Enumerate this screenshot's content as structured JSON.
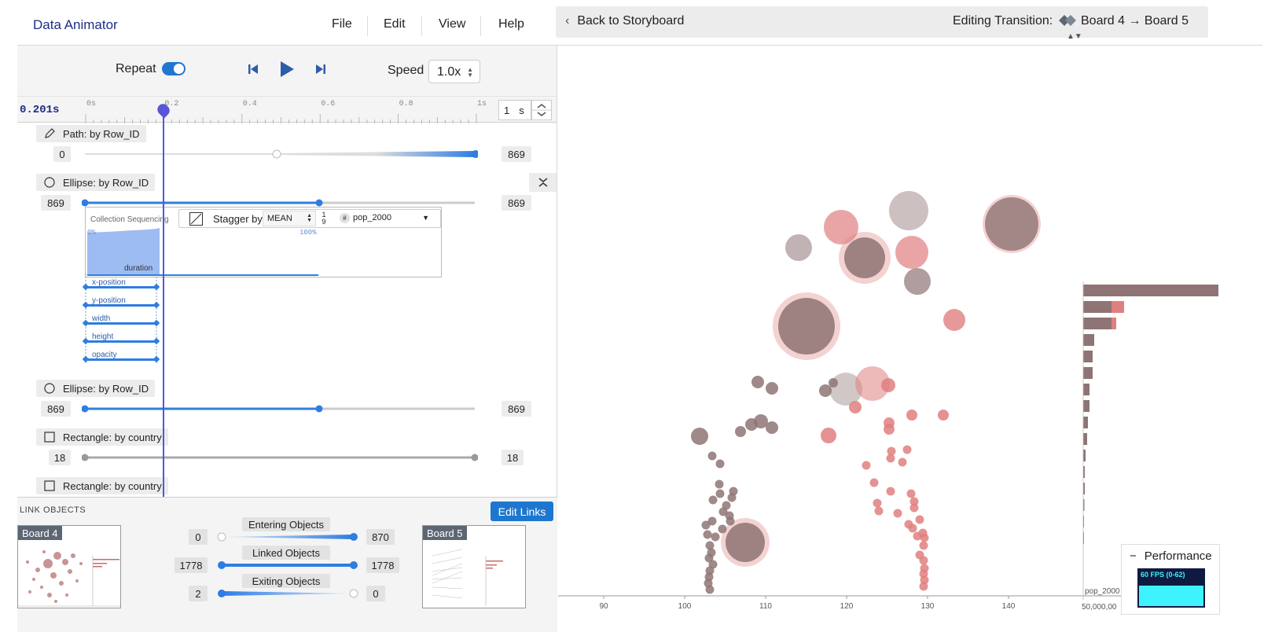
{
  "app": {
    "title": "Data Animator"
  },
  "menu": {
    "file": "File",
    "edit": "Edit",
    "view": "View",
    "help": "Help"
  },
  "transition_bar": {
    "back_label": "Back to Storyboard",
    "editing_label": "Editing Transition:",
    "board_select": "Board 4 → Board 5"
  },
  "playback": {
    "repeat_label": "Repeat",
    "repeat_on": true,
    "speed_label": "Speed",
    "speed_value": "1.0x"
  },
  "timeline": {
    "current_time": "0.201s",
    "ticks": [
      "0s",
      "0.2",
      "0.4",
      "0.6",
      "0.8",
      "1s"
    ],
    "duration_value": "1",
    "duration_unit": "s"
  },
  "tracks": [
    {
      "label": "Path: by Row_ID",
      "start": "0",
      "end": "869"
    },
    {
      "label": "Ellipse: by Row_ID",
      "start": "869",
      "end": "869"
    },
    {
      "label": "Ellipse: by Row_ID",
      "start": "869",
      "end": "869"
    },
    {
      "label": "Rectangle: by country",
      "start": "18",
      "end": "18"
    },
    {
      "label": "Rectangle: by country"
    }
  ],
  "sequencing": {
    "title": "Collection Sequencing",
    "stagger_label": "Stagger by",
    "stagger_agg": "MEAN",
    "order_top": "1",
    "order_bottom": "9",
    "field": "pop_2000",
    "pct_start": "0%",
    "pct_end": "100%",
    "duration_label": "duration",
    "properties": [
      "x-position",
      "y-position",
      "width",
      "height",
      "opacity"
    ]
  },
  "link_objects": {
    "title": "LINK OBJECTS",
    "edit_button": "Edit Links",
    "source_board": "Board 4",
    "target_board": "Board 5",
    "rows": [
      {
        "label": "Entering Objects",
        "left": "0",
        "right": "870"
      },
      {
        "label": "Linked Objects",
        "left": "1778",
        "right": "1778"
      },
      {
        "label": "Exiting Objects",
        "left": "2",
        "right": "0"
      }
    ]
  },
  "canvas": {
    "x_ticks": [
      "90",
      "100",
      "110",
      "120",
      "130",
      "140"
    ],
    "bar_axis_tick": "50,000,00",
    "bar_axis_label": "pop_2000"
  },
  "performance": {
    "title": "Performance",
    "fps": "60 FPS (0-62)"
  },
  "colors": {
    "accent": "#2176d2",
    "brown": "#8e7474",
    "salmon": "#e07f7f",
    "playhead": "#5755d9",
    "title": "#1c2f86"
  }
}
